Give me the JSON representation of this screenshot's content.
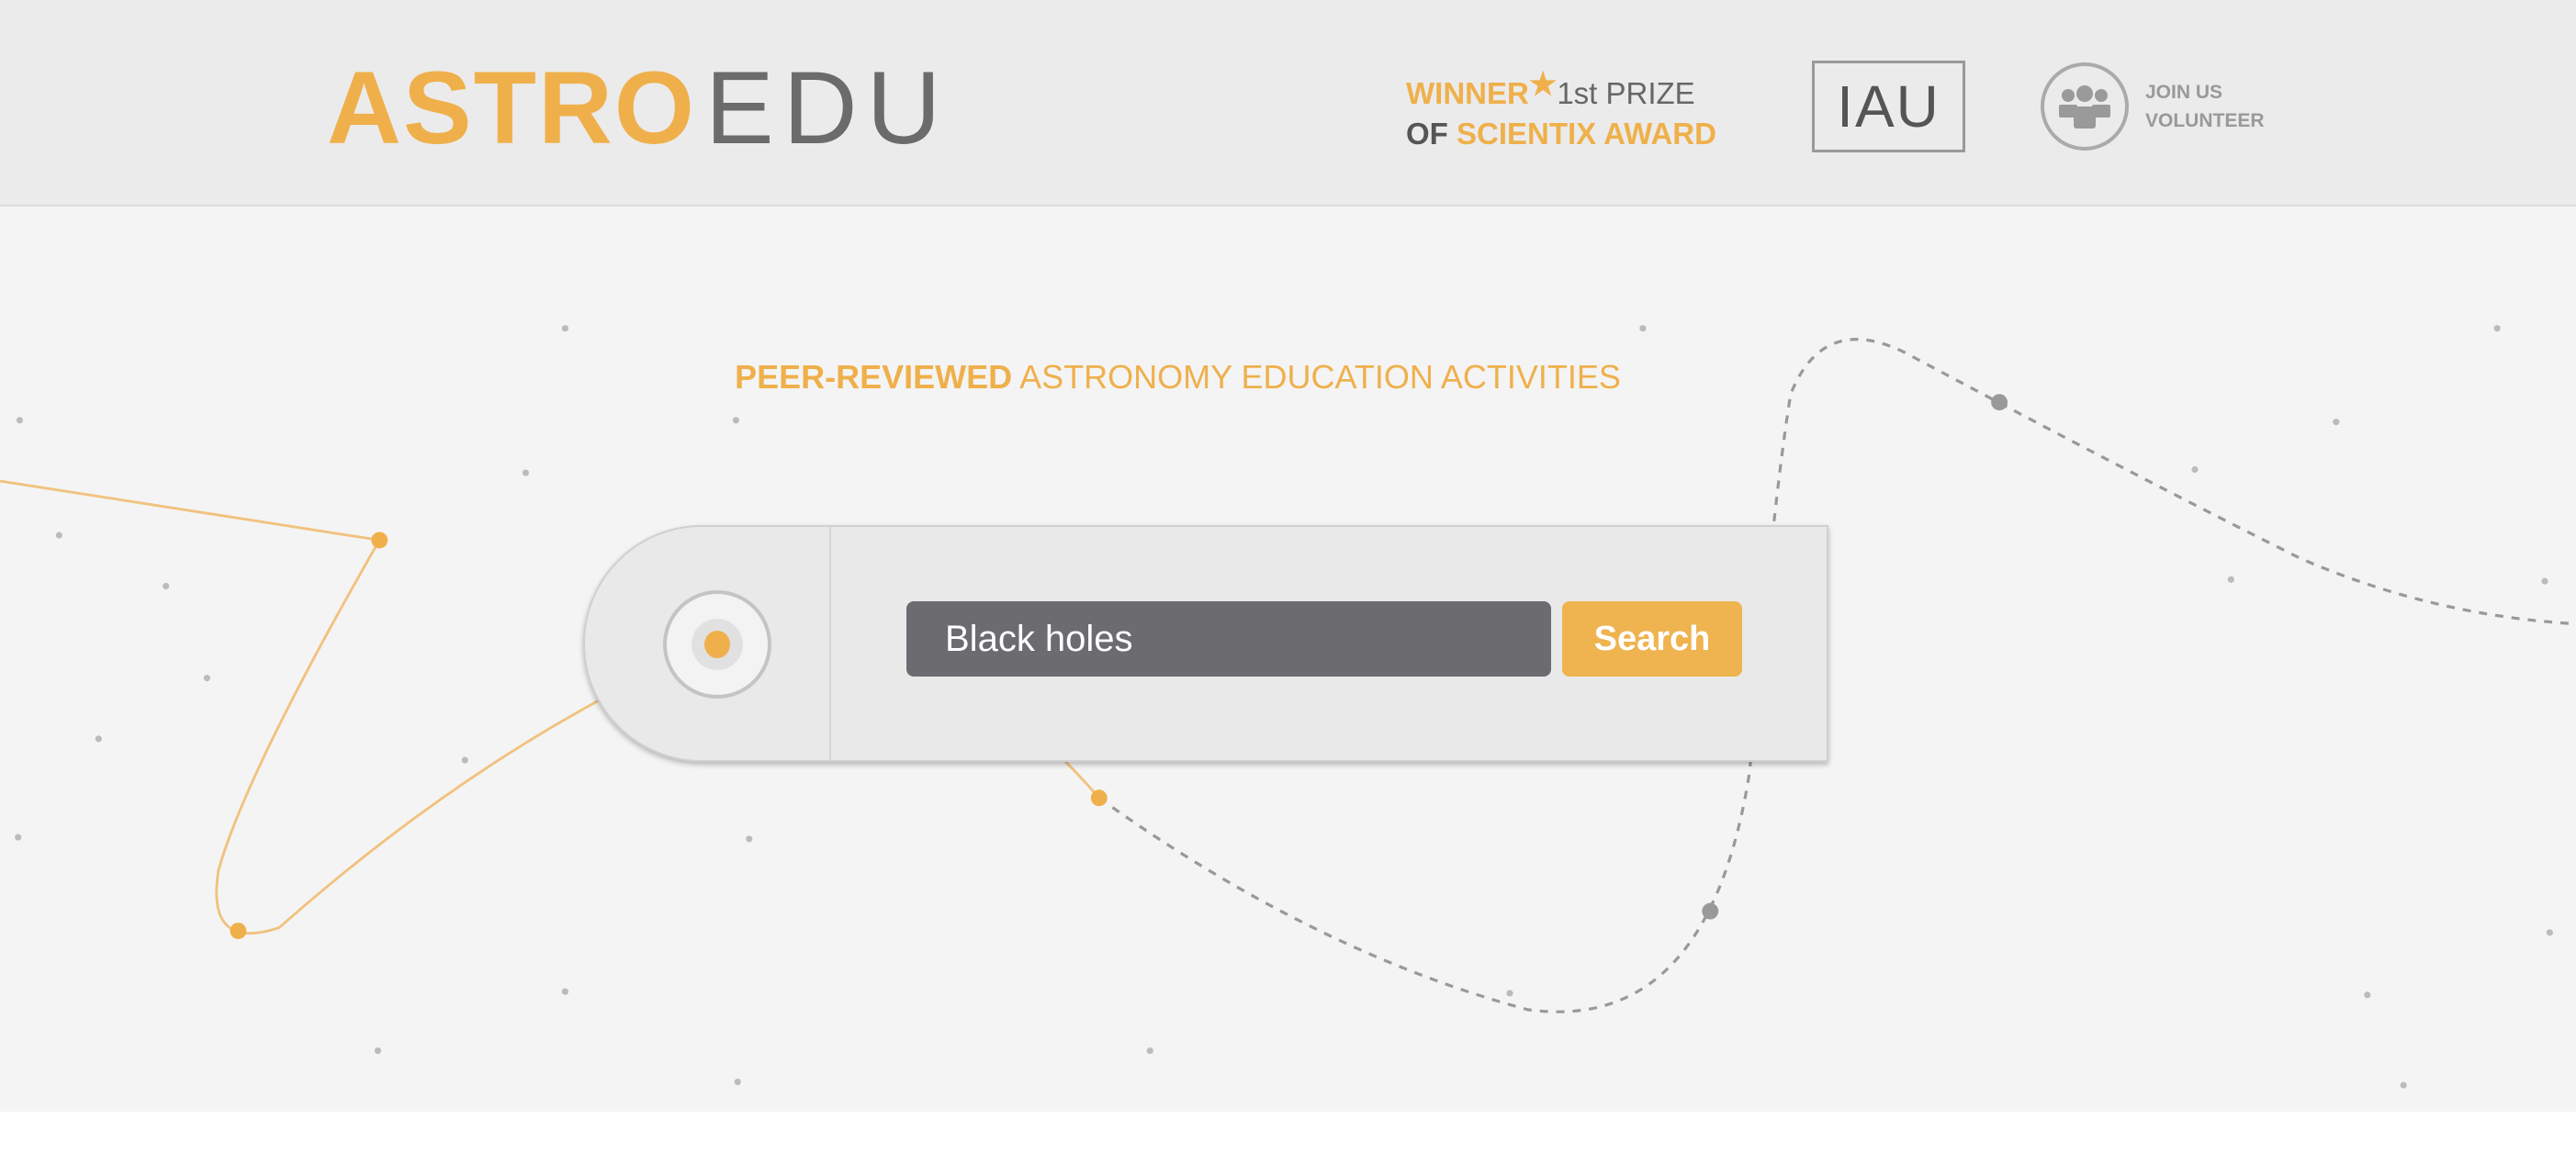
{
  "header": {
    "logo_primary": "ASTRO",
    "logo_secondary": "EDU",
    "award_winner": "WINNER",
    "award_prize": "1st PRIZE",
    "award_of": "OF",
    "award_name": "SCIENTIX AWARD",
    "iau_logo": "IAU",
    "join_line1": "JOIN US",
    "join_line2": "VOLUNTEER"
  },
  "hero": {
    "tagline_bold": "PEER-REVIEWED",
    "tagline_rest": "ASTRONOMY EDUCATION ACTIVITIES"
  },
  "search": {
    "value": "Black holes",
    "button_label": "Search"
  },
  "colors": {
    "accent": "#efb04b",
    "input_bg": "#6c6b70",
    "header_bg": "#ebebeb"
  }
}
